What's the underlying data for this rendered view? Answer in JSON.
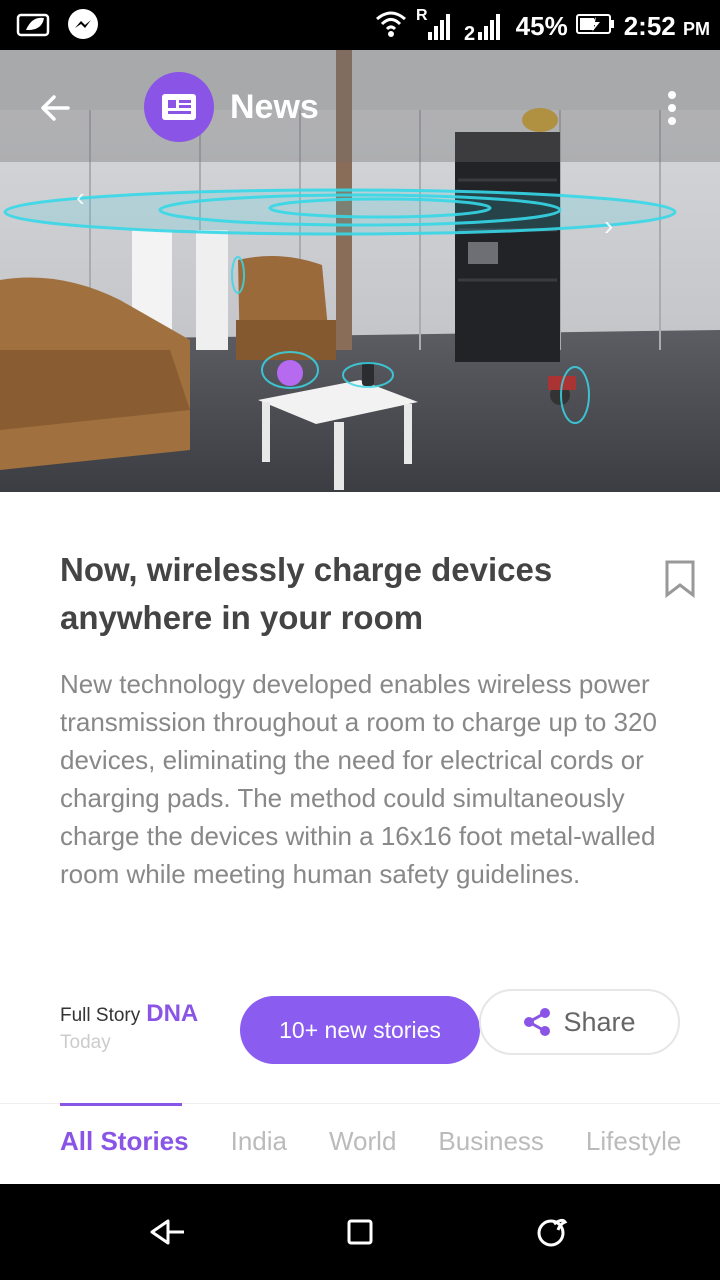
{
  "status_bar": {
    "battery": "45%",
    "time": "2:52",
    "ampm": "PM",
    "icons": [
      "leaf-icon",
      "messenger-icon",
      "wifi-icon",
      "signal-roaming-icon",
      "signal-icon",
      "battery-charging-icon"
    ]
  },
  "app_bar": {
    "title": "News",
    "back_icon": "back-arrow-icon",
    "app_icon": "newspaper-icon",
    "menu_icon": "more-vert-icon"
  },
  "hero": {
    "prev_icon": "chevron-left-icon",
    "next_icon": "chevron-right-icon"
  },
  "article": {
    "headline": "Now, wirelessly charge devices anywhere in your room",
    "summary": "New technology developed enables wireless power transmission throughout a room to charge up to 320 devices, eliminating the need for electrical cords or charging pads. The method could simultaneously charge the devices within a 16x16 foot metal-walled room while meeting human safety guidelines.",
    "full_story_label": "Full Story",
    "source": "DNA",
    "date": "Today",
    "bookmark_icon": "bookmark-icon"
  },
  "actions": {
    "new_stories": "10+ new stories",
    "share": "Share",
    "share_icon": "share-icon"
  },
  "tabs": [
    {
      "label": "All Stories",
      "active": true
    },
    {
      "label": "India",
      "active": false
    },
    {
      "label": "World",
      "active": false
    },
    {
      "label": "Business",
      "active": false
    },
    {
      "label": "Lifestyle",
      "active": false
    }
  ],
  "nav_bar": {
    "icons": [
      "nav-back-icon",
      "nav-recents-icon",
      "nav-home-icon"
    ]
  },
  "colors": {
    "accent": "#8a55e6",
    "button": "#8a5cf0",
    "hero_glow": "#37d8e8"
  }
}
